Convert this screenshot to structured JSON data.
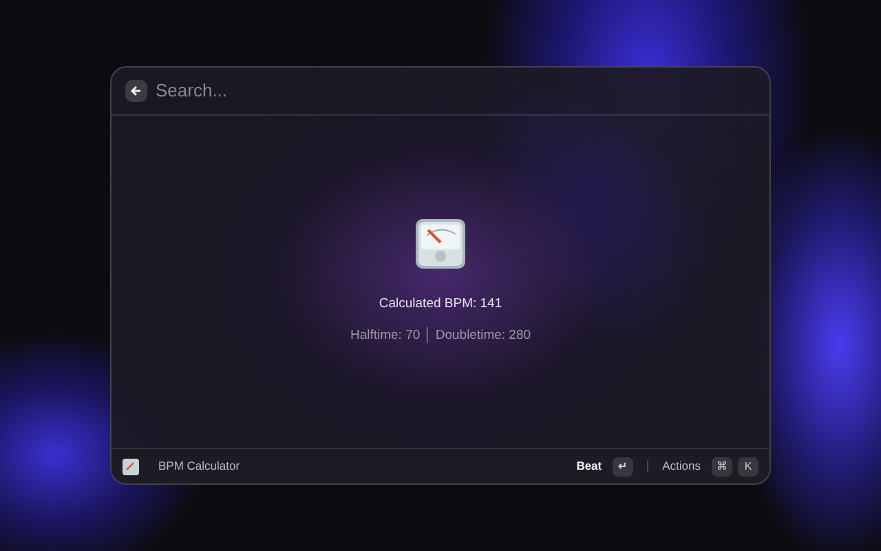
{
  "search": {
    "placeholder": "Search..."
  },
  "result": {
    "title": "Calculated BPM: 141",
    "details": "Halftime: 70 │ Doubletime: 280"
  },
  "footer": {
    "command": "BPM Calculator",
    "primary_action": {
      "label": "Beat",
      "keys": [
        "↵"
      ]
    },
    "actions": {
      "label": "Actions",
      "keys": [
        "⌘",
        "K"
      ]
    }
  }
}
